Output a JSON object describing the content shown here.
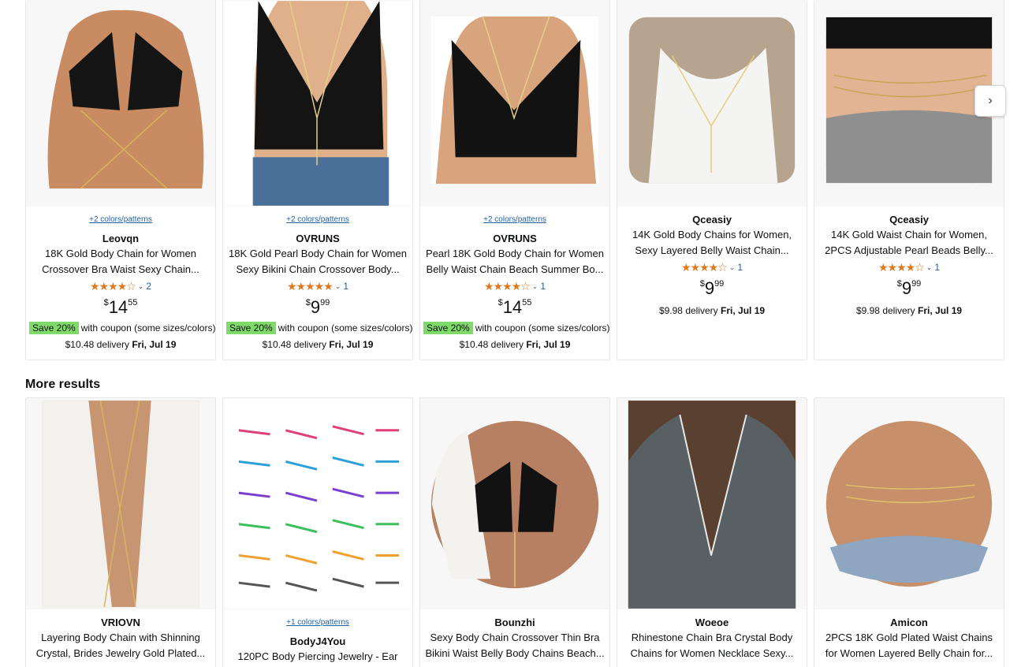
{
  "nav": {
    "next_arrow": "›"
  },
  "sections": {
    "more_results": "More results"
  },
  "top_row": [
    {
      "swatch": "+2 colors/patterns",
      "brand": "Leovqn",
      "title": "18K Gold Body Chain for Women Crossover Bra Waist Sexy Chain...",
      "stars": "★★★★☆",
      "rating_count": "2",
      "price_symbol": "$",
      "price_whole": "14",
      "price_fraction": "55",
      "coupon_badge": "Save 20%",
      "coupon_text": "with coupon (some sizes/colors)",
      "delivery_fee": "$10.48 delivery",
      "delivery_date": "Fri, Jul 19"
    },
    {
      "swatch": "+2 colors/patterns",
      "brand": "OVRUNS",
      "title": "18K Gold Pearl Body Chain for Women Sexy Bikini Chain Crossover Body...",
      "stars": "★★★★★",
      "rating_count": "1",
      "price_symbol": "$",
      "price_whole": "9",
      "price_fraction": "99",
      "coupon_badge": "Save 20%",
      "coupon_text": "with coupon (some sizes/colors)",
      "delivery_fee": "$10.48 delivery",
      "delivery_date": "Fri, Jul 19"
    },
    {
      "swatch": "+2 colors/patterns",
      "brand": "OVRUNS",
      "title": "Pearl 18K Gold Body Chain for Women Belly Waist Chain Beach Summer Bo...",
      "stars": "★★★★☆",
      "rating_count": "1",
      "price_symbol": "$",
      "price_whole": "14",
      "price_fraction": "55",
      "coupon_badge": "Save 20%",
      "coupon_text": "with coupon (some sizes/colors)",
      "delivery_fee": "$10.48 delivery",
      "delivery_date": "Fri, Jul 19"
    },
    {
      "brand": "Qceasiy",
      "title": "14K Gold Body Chains for Women, Sexy Layered Belly Waist Chain...",
      "stars": "★★★★☆",
      "rating_count": "1",
      "price_symbol": "$",
      "price_whole": "9",
      "price_fraction": "99",
      "delivery_fee": "$9.98 delivery",
      "delivery_date": "Fri, Jul 19"
    },
    {
      "brand": "Qceasiy",
      "title": "14K Gold Waist Chain for Women, 2PCS Adjustable Pearl Beads Belly...",
      "stars": "★★★★☆",
      "rating_count": "1",
      "price_symbol": "$",
      "price_whole": "9",
      "price_fraction": "99",
      "delivery_fee": "$9.98 delivery",
      "delivery_date": "Fri, Jul 19"
    }
  ],
  "bottom_row": [
    {
      "brand": "VRIOVN",
      "title": "Layering Body Chain with Shinning Crystal, Brides Jewelry Gold Plated..."
    },
    {
      "swatch": "+1 colors/patterns",
      "brand": "BodyJ4You",
      "title": "120PC Body Piercing Jewelry - Ear"
    },
    {
      "brand": "Bounzhi",
      "title": "Sexy Body Chain Crossover Thin Bra Bikini Waist Belly Body Chains Beach..."
    },
    {
      "brand": "Woeoe",
      "title": "Rhinestone Chain Bra Crystal Body Chains for Women Necklace Sexy..."
    },
    {
      "brand": "Amicon",
      "title": "2PCS 18K Gold Plated Waist Chains for Women Layered Belly Chain for..."
    }
  ],
  "colors": {
    "link": "#2162a1",
    "star": "#de7921",
    "coupon_badge": "#7fda69",
    "text": "#0f1111"
  }
}
